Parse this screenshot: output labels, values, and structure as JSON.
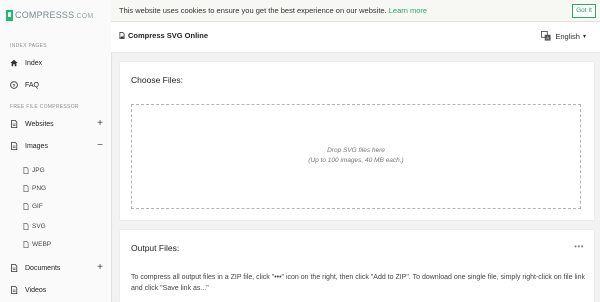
{
  "logo": {
    "name": "COMPRESSS",
    "domain": ".COM"
  },
  "sidebar": {
    "section1": "INDEX PAGES",
    "items_top": [
      {
        "label": "Index",
        "icon": "home-icon"
      },
      {
        "label": "FAQ",
        "icon": "help-circle-icon"
      }
    ],
    "section2": "FREE FILE COMPRESSOR",
    "websites": {
      "label": "Websites",
      "icon": "file-icon",
      "toggle": "+"
    },
    "images": {
      "label": "Images",
      "icon": "file-icon",
      "toggle": "−"
    },
    "subitems": [
      {
        "label": "JPG"
      },
      {
        "label": "PNG"
      },
      {
        "label": "GIF"
      },
      {
        "label": "SVG"
      },
      {
        "label": "WEBP"
      }
    ],
    "documents": {
      "label": "Documents",
      "icon": "file-icon",
      "toggle": "+"
    },
    "videos": {
      "label": "Videos",
      "icon": "file-icon"
    }
  },
  "cookie": {
    "text": "This website uses cookies to ensure you get the best experience on our website. ",
    "link": "Learn more",
    "button": "Got It"
  },
  "topbar": {
    "title": "Compress SVG Online",
    "language": "English"
  },
  "choose": {
    "title": "Choose Files:",
    "drop_line1": "Drop SVG files here",
    "drop_line2": "(Up to 100 images, 40 MB each.)"
  },
  "output": {
    "title": "Output Files:",
    "more": "•••",
    "description": "To compress all output files in a ZIP file, click \"•••\" icon on the right, then click \"Add to ZIP\". To download one single file, simply right-click on file link and click \"Save link as...\""
  },
  "colors": {
    "accent": "#2aa868",
    "logo_green": "#1bbc72"
  }
}
